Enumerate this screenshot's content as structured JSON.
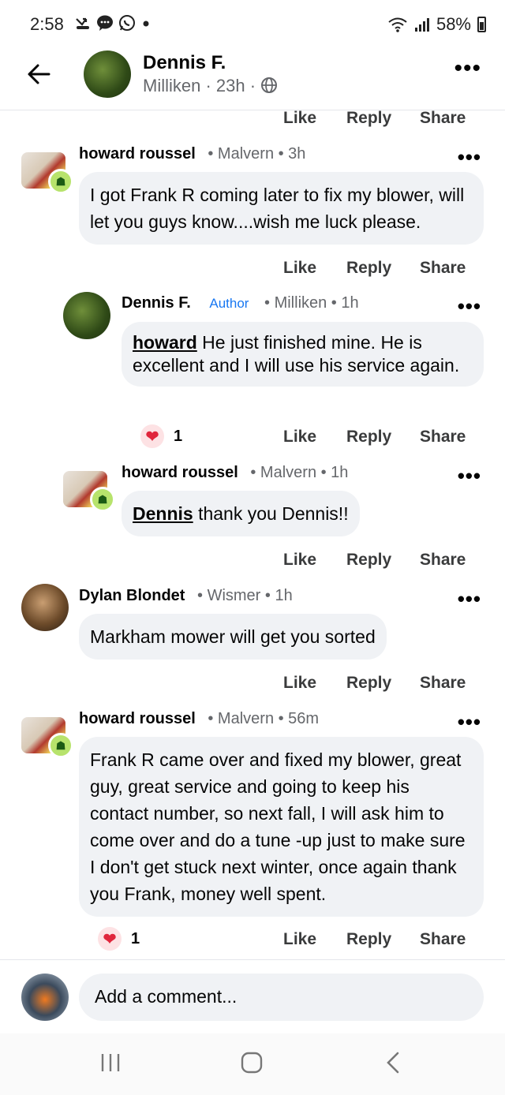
{
  "status": {
    "time": "2:58",
    "battery": "58%",
    "icons": [
      "missed-call-icon",
      "messenger-icon",
      "whatsapp-icon",
      "dot-icon"
    ],
    "right_icons": [
      "wifi-icon",
      "signal-icon",
      "battery-icon"
    ]
  },
  "header": {
    "name": "Dennis F.",
    "subtitle": "Milliken · 23h ·",
    "globe": "globe-icon"
  },
  "top_actions": {
    "like": "Like",
    "reply": "Reply",
    "share": "Share"
  },
  "comments": [
    {
      "name": "howard roussel",
      "meta": "•  Malvern  •  3h",
      "mention": "",
      "text": "I got Frank R coming later to fix my blower, will let you guys know....wish me luck please.",
      "like": "Like",
      "reply": "Reply",
      "share": "Share"
    },
    {
      "name": "Dennis F.",
      "author": "Author",
      "meta": "•  Milliken  •  1h",
      "mention": "howard",
      "text": " He just finished mine. He is excellent and I will use his service again.",
      "reactions": "1",
      "like": "Like",
      "reply": "Reply",
      "share": "Share"
    },
    {
      "name": "howard roussel",
      "meta": "•  Malvern  •  1h",
      "mention": "Dennis",
      "text": " thank you Dennis!!",
      "like": "Like",
      "reply": "Reply",
      "share": "Share"
    },
    {
      "name": "Dylan Blondet",
      "meta": "•  Wismer  •  1h",
      "mention": "",
      "text": "Markham mower will get you sorted",
      "like": "Like",
      "reply": "Reply",
      "share": "Share"
    },
    {
      "name": "howard roussel",
      "meta": "•  Malvern  •  56m",
      "mention": "",
      "text": "Frank R came over and fixed my blower, great guy, great service and going to keep his contact number, so next fall, I will ask him to come over and do a tune -up just to make sure I don't get stuck next winter, once again thank you Frank, money well spent.",
      "reactions": "1",
      "like": "Like",
      "reply": "Reply",
      "share": "Share"
    }
  ],
  "composer": {
    "placeholder": "Add a comment..."
  },
  "colors": {
    "link": "#1877f2",
    "bubble": "#f0f2f5",
    "heart": "#e0263c",
    "badge": "#b7e36c"
  }
}
